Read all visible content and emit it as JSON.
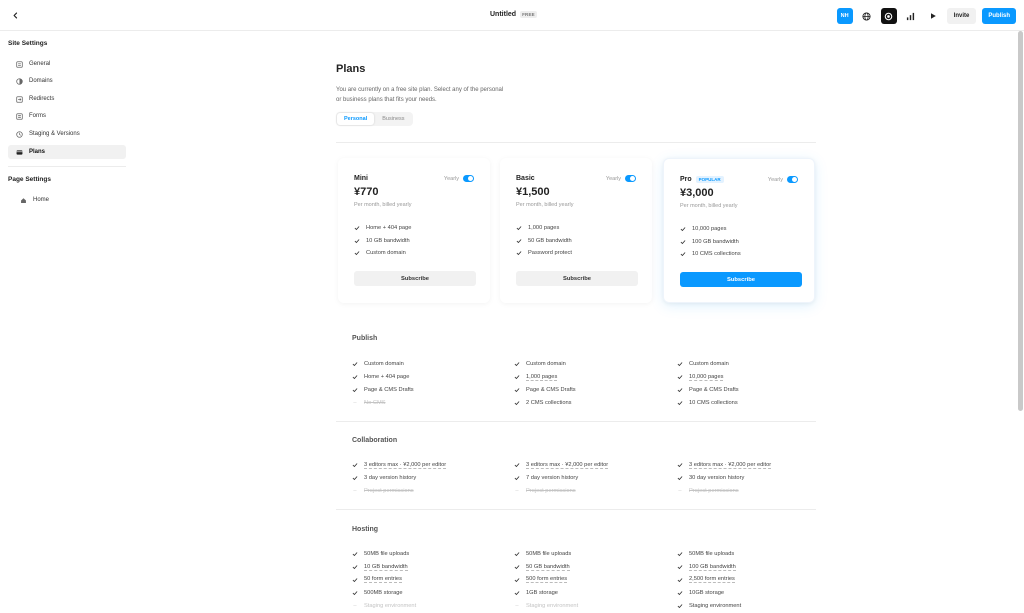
{
  "topbar": {
    "title": "Untitled",
    "badge": "FREE",
    "avatar_initials": "NH",
    "invite_label": "Invite",
    "publish_label": "Publish"
  },
  "sidebar": {
    "site_settings_title": "Site Settings",
    "items": [
      {
        "label": "General",
        "icon": "settings-square-icon"
      },
      {
        "label": "Domains",
        "icon": "globe-icon"
      },
      {
        "label": "Redirects",
        "icon": "redirect-icon"
      },
      {
        "label": "Forms",
        "icon": "form-icon"
      },
      {
        "label": "Staging & Versions",
        "icon": "staging-icon"
      },
      {
        "label": "Plans",
        "icon": "card-icon"
      }
    ],
    "page_settings_title": "Page Settings",
    "pages": [
      {
        "label": "Home",
        "icon": "home-icon"
      }
    ]
  },
  "main": {
    "title": "Plans",
    "description": "You are currently on a free site plan. Select any of the personal or business plans that fits your needs.",
    "tabs": [
      {
        "label": "Personal",
        "active": true
      },
      {
        "label": "Business",
        "active": false
      }
    ]
  },
  "plans": [
    {
      "name": "Mini",
      "popular": "",
      "billing_label": "Yearly",
      "price": "¥770",
      "per": "Per month, billed yearly",
      "features": [
        "Home + 404 page",
        "10 GB bandwidth",
        "Custom domain"
      ],
      "button": "Subscribe"
    },
    {
      "name": "Basic",
      "popular": "",
      "billing_label": "Yearly",
      "price": "¥1,500",
      "per": "Per month, billed yearly",
      "features": [
        "1,000 pages",
        "50 GB bandwidth",
        "Password protect"
      ],
      "button": "Subscribe"
    },
    {
      "name": "Pro",
      "popular": "POPULAR",
      "billing_label": "Yearly",
      "price": "¥3,000",
      "per": "Per month, billed yearly",
      "features": [
        "10,000 pages",
        "100 GB bandwidth",
        "10 CMS collections"
      ],
      "button": "Subscribe"
    }
  ],
  "sections": {
    "publish": {
      "label": "Publish",
      "columns": [
        [
          "Custom domain",
          "Home + 404 page",
          "Page & CMS Drafts",
          "No CMS"
        ],
        [
          "Custom domain",
          "1,000 pages",
          "Page & CMS Drafts",
          "2 CMS collections"
        ],
        [
          "Custom domain",
          "10,000 pages",
          "Page & CMS Drafts",
          "10 CMS collections"
        ]
      ]
    },
    "collaboration": {
      "label": "Collaboration",
      "columns": [
        [
          "3 editors max · ¥2,000 per editor",
          "3 day version history",
          "Project permissions"
        ],
        [
          "3 editors max · ¥2,000 per editor",
          "7 day version history",
          "Project permissions"
        ],
        [
          "3 editors max · ¥2,000 per editor",
          "30 day version history",
          "Project permissions"
        ]
      ]
    },
    "hosting": {
      "label": "Hosting",
      "columns": [
        [
          "50MB file uploads",
          "10 GB bandwidth",
          "50 form entries",
          "500MB storage",
          "Staging environment"
        ],
        [
          "50MB file uploads",
          "50 GB bandwidth",
          "500 form entries",
          "1GB storage",
          "Staging environment"
        ],
        [
          "50MB file uploads",
          "100 GB bandwidth",
          "2,500 form entries",
          "10GB storage",
          "Staging environment"
        ]
      ]
    }
  },
  "colors": {
    "accent": "#0a99ff"
  }
}
